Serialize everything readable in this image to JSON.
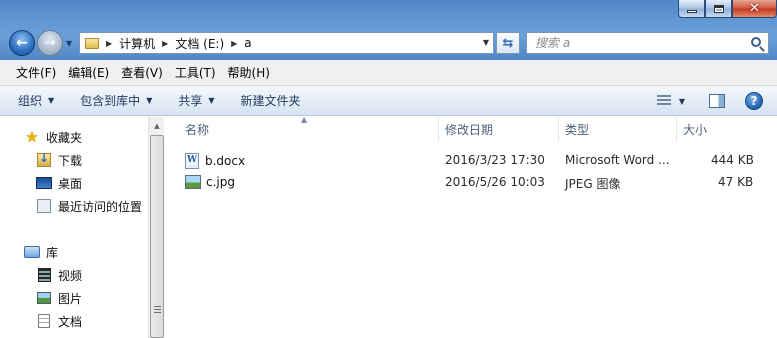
{
  "window": {
    "controls": {
      "minimize": "minimize",
      "maximize": "maximize",
      "close": "✕"
    }
  },
  "address": {
    "crumbs": [
      "计算机",
      "文档 (E:)",
      "a"
    ]
  },
  "search": {
    "placeholder": "搜索 a"
  },
  "menu": [
    "文件(F)",
    "编辑(E)",
    "查看(V)",
    "工具(T)",
    "帮助(H)"
  ],
  "commands": [
    "组织",
    "包含到库中",
    "共享",
    "新建文件夹"
  ],
  "navpane": {
    "favorites": {
      "title": "收藏夹",
      "items": [
        "下载",
        "桌面",
        "最近访问的位置"
      ]
    },
    "libraries": {
      "title": "库",
      "items": [
        "视频",
        "图片",
        "文档"
      ]
    }
  },
  "columns": {
    "name": "名称",
    "date": "修改日期",
    "type": "类型",
    "size": "大小"
  },
  "files": [
    {
      "name": "b.docx",
      "date": "2016/3/23 17:30",
      "type": "Microsoft Word ...",
      "size": "444 KB",
      "icon": "word-document-icon"
    },
    {
      "name": "c.jpg",
      "date": "2016/5/26 10:03",
      "type": "JPEG 图像",
      "size": "47 KB",
      "icon": "jpeg-image-icon"
    }
  ],
  "colors": {
    "accent": "#4f86c6",
    "command_text": "#1e395b",
    "header_text": "#4c607a"
  }
}
